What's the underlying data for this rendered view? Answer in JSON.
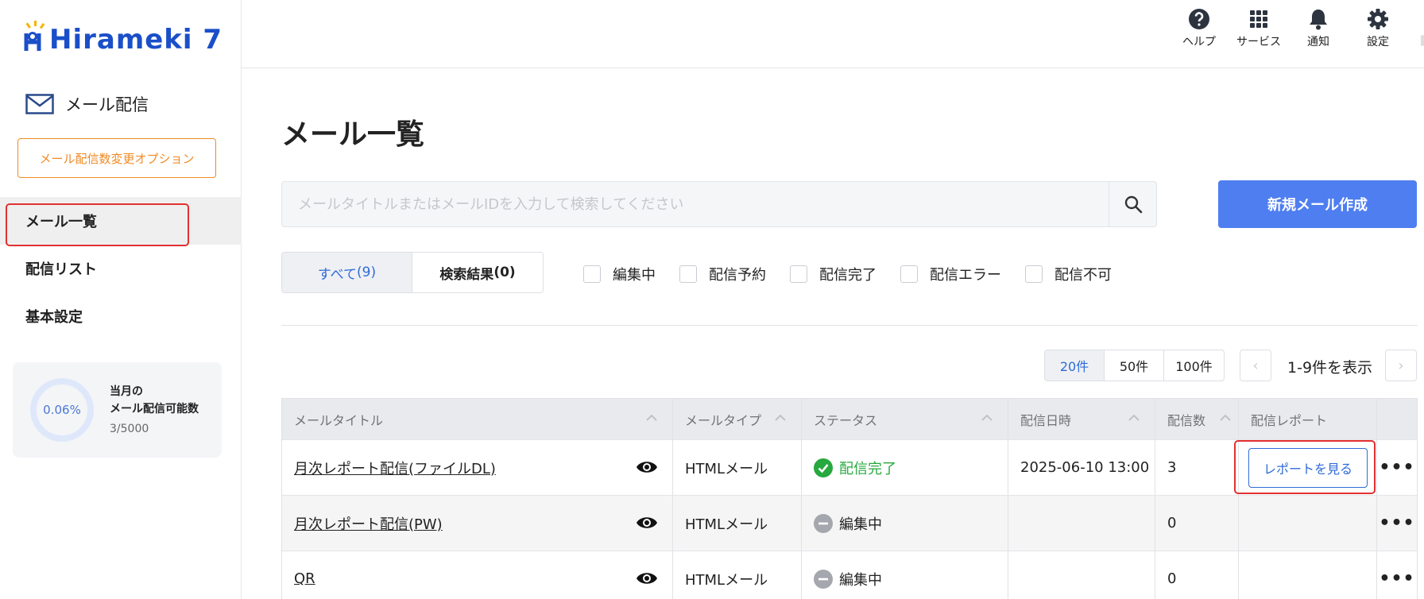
{
  "brand": {
    "name": "Hirameki 7",
    "accent": "#1a4fc9"
  },
  "sidebar": {
    "section_title": "メール配信",
    "option_button": "メール配信数変更オプション",
    "items": [
      {
        "label": "メール一覧",
        "active": true
      },
      {
        "label": "配信リスト",
        "active": false
      },
      {
        "label": "基本設定",
        "active": false
      }
    ],
    "quota": {
      "percent": "0.06%",
      "line1": "当月の",
      "line2": "メール配信可能数",
      "count": "3/5000"
    }
  },
  "header": {
    "tools": [
      {
        "label": "ヘルプ",
        "icon": "help-icon"
      },
      {
        "label": "サービス",
        "icon": "grid-icon"
      },
      {
        "label": "通知",
        "icon": "bell-icon"
      },
      {
        "label": "設定",
        "icon": "gear-icon"
      }
    ]
  },
  "main": {
    "title": "メール一覧",
    "search_placeholder": "メールタイトルまたはメールIDを入力して検索してください",
    "new_button": "新規メール作成",
    "tabs": [
      {
        "label": "すべて",
        "count": "(9)"
      },
      {
        "label": "検索結果",
        "count": "(0)"
      }
    ],
    "filters": [
      "編集中",
      "配信予約",
      "配信完了",
      "配信エラー",
      "配信不可"
    ],
    "page_sizes": [
      "20件",
      "50件",
      "100件"
    ],
    "page_size_selected": "20件",
    "range_text": "1-9件を表示"
  },
  "table": {
    "columns": [
      "メールタイトル",
      "メールタイプ",
      "ステータス",
      "配信日時",
      "配信数",
      "配信レポート"
    ],
    "rows": [
      {
        "title": "月次レポート配信(ファイルDL)",
        "type": "HTMLメール",
        "status": "配信完了",
        "status_kind": "done",
        "date": "2025-06-10 13:00",
        "count": "3",
        "report": "レポートを見る"
      },
      {
        "title": "月次レポート配信(PW)",
        "type": "HTMLメール",
        "status": "編集中",
        "status_kind": "draft",
        "date": "",
        "count": "0",
        "report": ""
      },
      {
        "title": "QR",
        "type": "HTMLメール",
        "status": "編集中",
        "status_kind": "draft",
        "date": "",
        "count": "0",
        "report": ""
      }
    ]
  },
  "colors": {
    "primary": "#4e7ef0",
    "orange": "#f08a24",
    "success": "#27a93f",
    "highlight": "#e23030"
  }
}
